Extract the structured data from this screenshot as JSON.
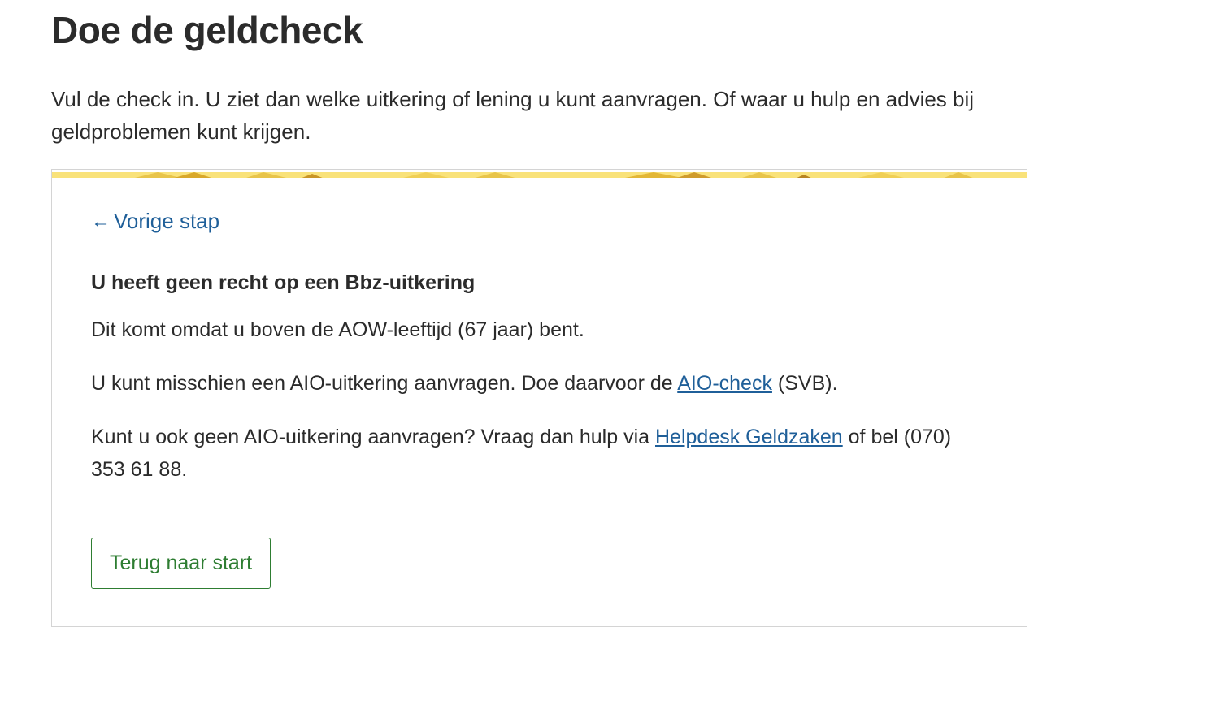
{
  "page": {
    "title": "Doe de geldcheck",
    "intro": "Vul de check in. U ziet dan welke uitkering of lening u kunt aanvragen. Of waar u hulp en advies bij geldproblemen kunt krijgen."
  },
  "card": {
    "back_link": "Vorige stap",
    "back_icon": "arrow-left-icon",
    "result_heading": "U heeft geen recht op een Bbz-uitkering",
    "reason": "Dit komt omdat u boven de AOW-leeftijd (67 jaar) bent.",
    "aio": {
      "before": "U kunt misschien een AIO-uitkering aanvragen. Doe daarvoor de ",
      "link": "AIO-check",
      "after": " (SVB)."
    },
    "helpdesk": {
      "before": "Kunt u ook geen AIO-uitkering aanvragen? Vraag dan hulp via ",
      "link": "Helpdesk Geldzaken",
      "after": " of bel (070) 353 61 88."
    },
    "restart_button": "Terug naar start"
  },
  "colors": {
    "link": "#1f5f99",
    "button": "#2e7d32",
    "stripe_base": "#f9e27a",
    "stripe_accent": "#e8b923"
  }
}
